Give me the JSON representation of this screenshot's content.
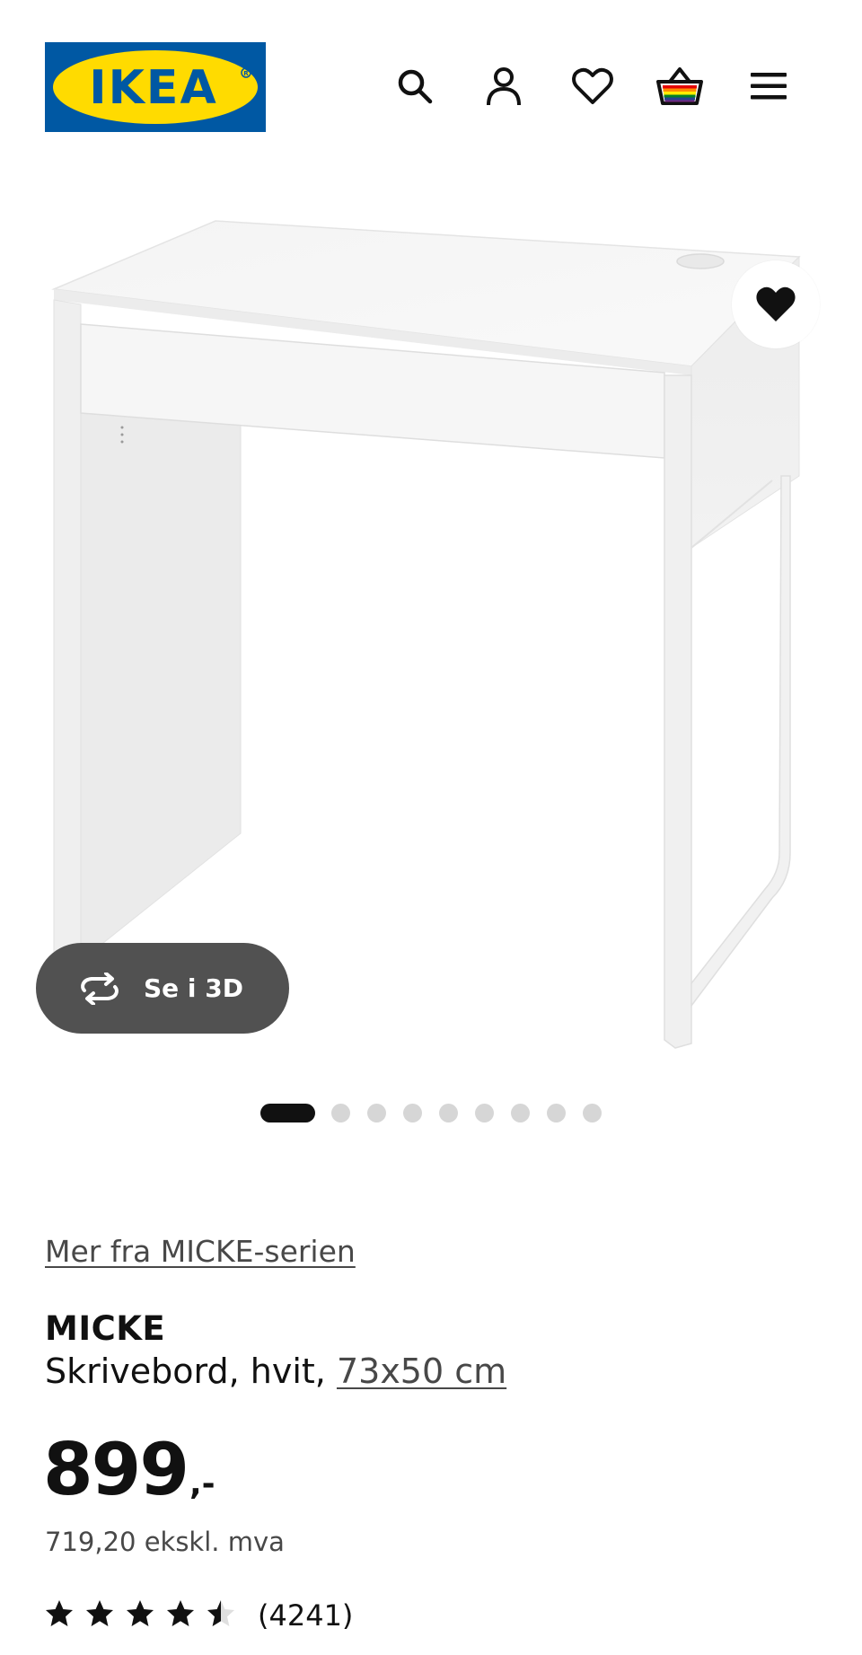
{
  "header": {
    "logo_text": "IKEA",
    "logo_colors": {
      "blue": "#0058a3",
      "yellow": "#ffdb00"
    },
    "icons": [
      "search-icon",
      "account-icon",
      "wishlist-icon",
      "basket-icon",
      "menu-icon"
    ]
  },
  "hero": {
    "image": "white-desk-micke",
    "favorite_icon": "heart-filled-icon",
    "view_3d_label": "Se i 3D",
    "view_3d_icon": "rotate-3d-icon",
    "carousel": {
      "total": 9,
      "active": 1
    }
  },
  "product": {
    "series_link": "Mer fra MICKE-serien",
    "name": "MICKE",
    "description": "Skrivebord, hvit, ",
    "size": "73x50 cm",
    "price_integer": "899",
    "price_decimal": ",-",
    "price_ex_vat": "719,20 ekskl. mva",
    "rating": 4.5,
    "rating_max": 5,
    "review_count": "(4241)"
  }
}
